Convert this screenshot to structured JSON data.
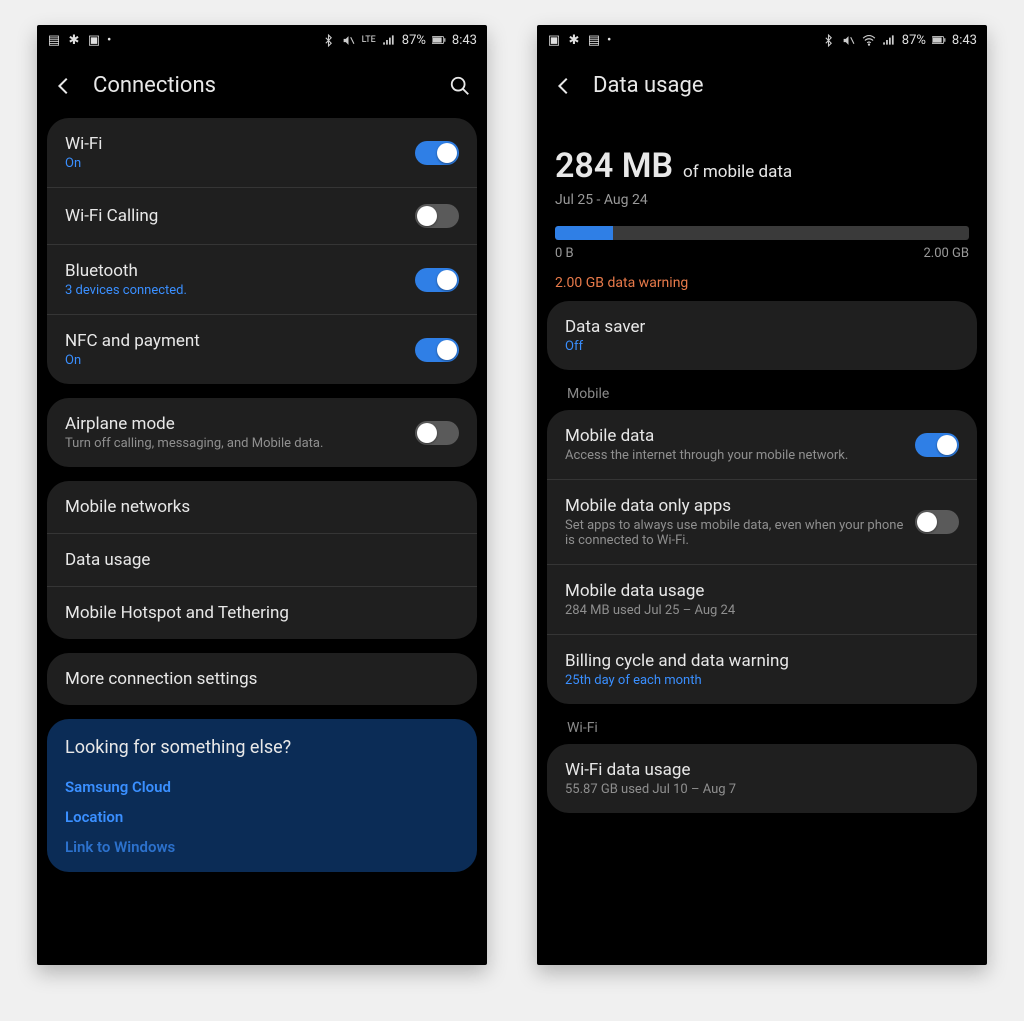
{
  "status": {
    "battery": "87%",
    "time": "8:43",
    "lte": "LTE"
  },
  "left": {
    "title": "Connections",
    "group1": [
      {
        "title": "Wi-Fi",
        "sub": "On",
        "subBlue": true,
        "toggle": true,
        "on": true
      },
      {
        "title": "Wi-Fi Calling",
        "sub": "",
        "toggle": true,
        "on": false
      },
      {
        "title": "Bluetooth",
        "sub": "3 devices connected.",
        "subBlue": true,
        "toggle": true,
        "on": true
      },
      {
        "title": "NFC and payment",
        "sub": "On",
        "subBlue": true,
        "toggle": true,
        "on": true
      }
    ],
    "group2": [
      {
        "title": "Airplane mode",
        "sub": "Turn off calling, messaging, and Mobile data.",
        "toggle": true,
        "on": false
      }
    ],
    "group3": [
      {
        "title": "Mobile networks"
      },
      {
        "title": "Data usage"
      },
      {
        "title": "Mobile Hotspot and Tethering"
      }
    ],
    "group4": [
      {
        "title": "More connection settings"
      }
    ],
    "looking": {
      "title": "Looking for something else?",
      "links": [
        "Samsung Cloud",
        "Location",
        "Link to Windows"
      ]
    }
  },
  "right": {
    "title": "Data usage",
    "usage": {
      "amount": "284 MB",
      "of": "of mobile data",
      "range": "Jul 25 - Aug 24",
      "barPercent": 14,
      "min": "0 B",
      "max": "2.00 GB",
      "warning": "2.00 GB data warning"
    },
    "saver": {
      "title": "Data saver",
      "sub": "Off",
      "subBlue": true
    },
    "mobileLabel": "Mobile",
    "mobileGroup": [
      {
        "title": "Mobile data",
        "sub": "Access the internet through your mobile network.",
        "toggle": true,
        "on": true
      },
      {
        "title": "Mobile data only apps",
        "sub": "Set apps to always use mobile data, even when your phone is connected to Wi-Fi.",
        "toggle": true,
        "on": false
      },
      {
        "title": "Mobile data usage",
        "sub": "284 MB used Jul 25 – Aug 24"
      },
      {
        "title": "Billing cycle and data warning",
        "sub": "25th day of each month",
        "subBlue": true
      }
    ],
    "wifiLabel": "Wi-Fi",
    "wifiGroup": [
      {
        "title": "Wi-Fi data usage",
        "sub": "55.87 GB used Jul 10 – Aug 7"
      }
    ]
  }
}
